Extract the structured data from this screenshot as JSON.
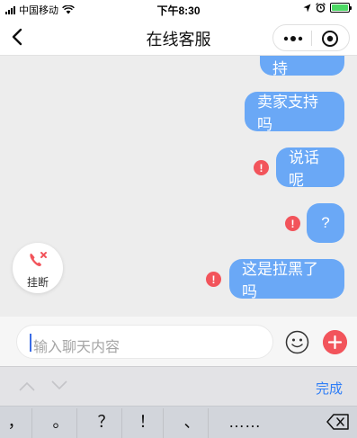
{
  "status_bar": {
    "carrier": "中国移动",
    "time": "下午8:30",
    "battery_color": "#4cd964"
  },
  "nav": {
    "title": "在线客服",
    "back_icon": "chevron-left-icon",
    "more_icon": "more-dots-icon",
    "close_icon": "target-close-icon"
  },
  "messages": [
    {
      "text": "哪里支持",
      "from": "me",
      "failed": false
    },
    {
      "text": "卖家支持吗",
      "from": "me",
      "failed": false
    },
    {
      "text": "说话呢",
      "from": "me",
      "failed": true
    },
    {
      "text": "?",
      "from": "me",
      "failed": true
    },
    {
      "text": "这是拉黑了吗",
      "from": "me",
      "failed": true
    }
  ],
  "hangup": {
    "label": "挂断"
  },
  "composer": {
    "placeholder": "输入聊天内容",
    "emoji_icon": "emoji-smile-icon",
    "plus_icon": "plus-icon"
  },
  "keyboard": {
    "done_label": "完成",
    "keys": [
      "，",
      "。",
      "？",
      "！",
      "、",
      "……"
    ]
  },
  "colors": {
    "bubble": "#6aa8f6",
    "error": "#f2545b",
    "accent": "#2f7ef6"
  }
}
